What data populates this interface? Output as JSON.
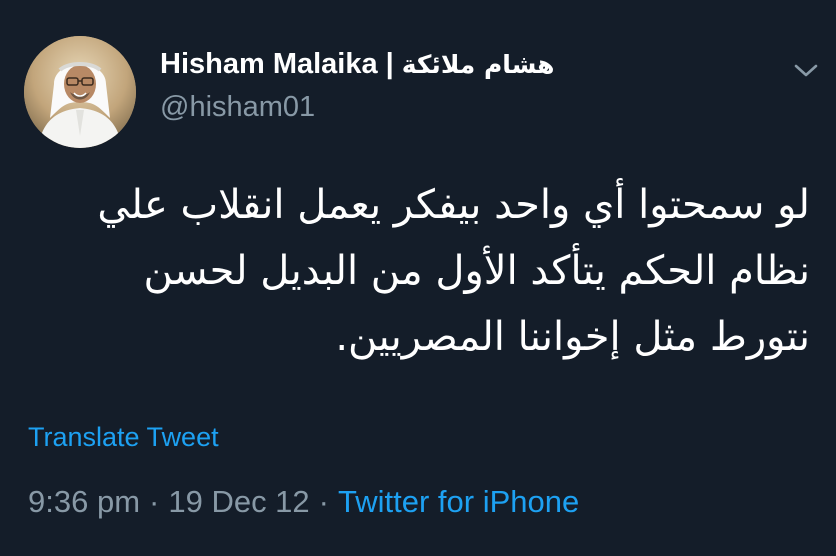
{
  "tweet": {
    "author": {
      "display_name": "Hisham Malaika",
      "separator": "|",
      "arabic_name": "هشام ملائكة",
      "handle": "@hisham01"
    },
    "body_lines": [
      "لو سمحتوا أي واحد بيفكر يعمل انقلاب علي",
      "نظام الحكم يتأكد الأول من البديل لحسن",
      "نتورط مثل إخواننا المصريين."
    ],
    "translate_label": "Translate Tweet",
    "time": "9:36 pm",
    "dot": "·",
    "date": "19 Dec 12",
    "source": "Twitter for iPhone",
    "icons": {
      "menu": "chevron-down-icon"
    },
    "colors": {
      "background": "#141d29",
      "link": "#1da1f2",
      "secondary": "#8899a6"
    }
  }
}
